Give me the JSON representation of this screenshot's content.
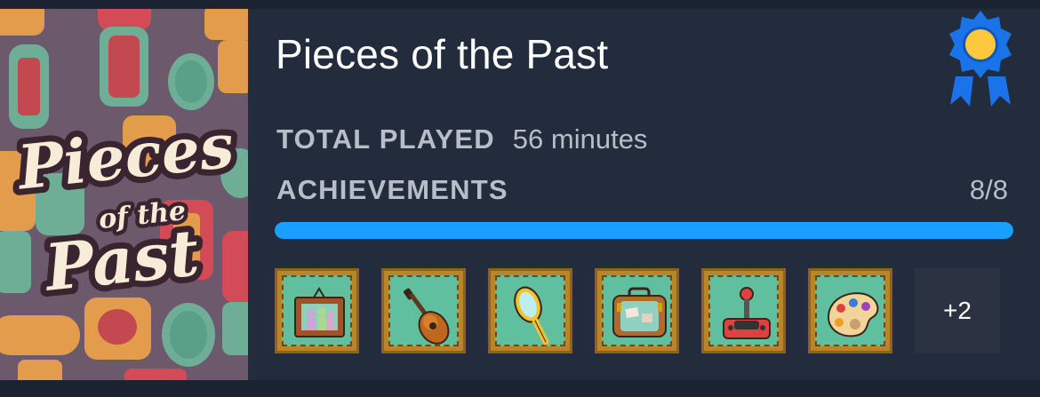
{
  "game": {
    "title": "Pieces of the Past",
    "cover_logo": [
      "Pieces",
      "of the",
      "Past"
    ]
  },
  "stats": {
    "total_played_label": "TOTAL PLAYED",
    "total_played_value": "56 minutes",
    "achievements_label": "ACHIEVEMENTS",
    "achievements_count": "8/8",
    "progress_fraction": 1.0
  },
  "achievement_icons": [
    {
      "name": "family-portrait-icon"
    },
    {
      "name": "ukulele-icon"
    },
    {
      "name": "hand-mirror-icon"
    },
    {
      "name": "suitcase-icon"
    },
    {
      "name": "joystick-icon"
    },
    {
      "name": "paint-palette-icon"
    }
  ],
  "more_label": "+2",
  "colors": {
    "progress": "#1a9fff",
    "badge": "#1a73e8",
    "badge_center": "#ffc83d"
  }
}
